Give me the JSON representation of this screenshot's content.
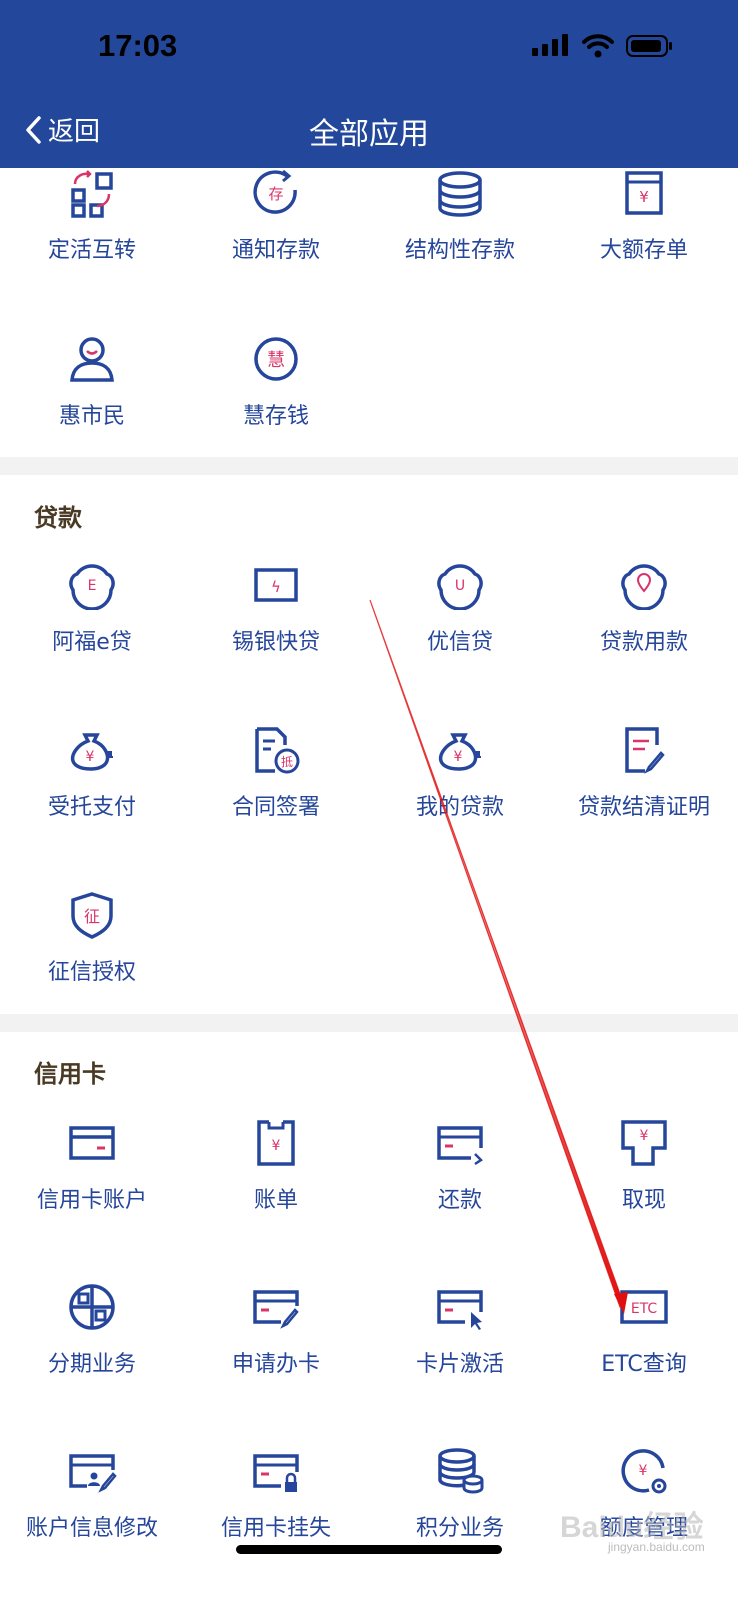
{
  "status": {
    "time": "17:03"
  },
  "nav": {
    "back_label": "返回",
    "title": "全部应用"
  },
  "sections": {
    "deposit": {
      "items": [
        {
          "label": "定活互转",
          "icon": "transfer-icon"
        },
        {
          "label": "通知存款",
          "icon": "notice-deposit-icon",
          "glyph": "存"
        },
        {
          "label": "结构性存款",
          "icon": "coins-stack-icon"
        },
        {
          "label": "大额存单",
          "icon": "certificate-icon",
          "glyph": "¥"
        },
        {
          "label": "惠市民",
          "icon": "person-icon"
        },
        {
          "label": "慧存钱",
          "icon": "hui-icon",
          "glyph": "慧"
        }
      ]
    },
    "loan": {
      "title": "贷款",
      "items": [
        {
          "label": "阿福e贷",
          "icon": "face-e-icon",
          "glyph": "E"
        },
        {
          "label": "锡银快贷",
          "icon": "lightning-card-icon",
          "glyph": "ϟ"
        },
        {
          "label": "优信贷",
          "icon": "face-u-icon",
          "glyph": "U"
        },
        {
          "label": "贷款用款",
          "icon": "face-pin-icon"
        },
        {
          "label": "受托支付",
          "icon": "money-bag-icon",
          "glyph": "¥"
        },
        {
          "label": "合同签署",
          "icon": "contract-icon",
          "glyph": "抵"
        },
        {
          "label": "我的贷款",
          "icon": "money-bag-icon",
          "glyph": "¥"
        },
        {
          "label": "贷款结清证明",
          "icon": "document-edit-icon"
        },
        {
          "label": "征信授权",
          "icon": "shield-icon",
          "glyph": "征"
        }
      ]
    },
    "credit": {
      "title": "信用卡",
      "items": [
        {
          "label": "信用卡账户",
          "icon": "card-icon"
        },
        {
          "label": "账单",
          "icon": "bill-icon",
          "glyph": "¥"
        },
        {
          "label": "还款",
          "icon": "repay-card-icon"
        },
        {
          "label": "取现",
          "icon": "cash-icon",
          "glyph": "¥"
        },
        {
          "label": "分期业务",
          "icon": "installment-icon"
        },
        {
          "label": "申请办卡",
          "icon": "card-apply-icon"
        },
        {
          "label": "卡片激活",
          "icon": "card-activate-icon"
        },
        {
          "label": "ETC查询",
          "icon": "etc-icon",
          "glyph": "ETC"
        },
        {
          "label": "账户信息修改",
          "icon": "card-user-edit-icon"
        },
        {
          "label": "信用卡挂失",
          "icon": "card-lock-icon"
        },
        {
          "label": "积分业务",
          "icon": "coins-stack-icon"
        },
        {
          "label": "额度管理",
          "icon": "limit-gear-icon",
          "glyph": "¥"
        }
      ]
    }
  },
  "colors": {
    "header": "#23479a",
    "icon": "#25469a",
    "accent": "#d8356a",
    "arrow": "#e01010"
  },
  "watermark": {
    "main": "Baidu经验",
    "sub": "jingyan.baidu.com"
  }
}
